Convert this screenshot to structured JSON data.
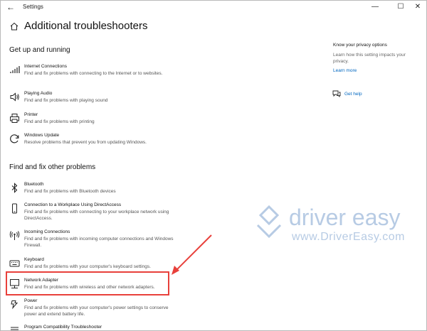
{
  "window": {
    "title": "Settings",
    "back_glyph": "←",
    "minimize_glyph": "—",
    "maximize_glyph": "☐",
    "close_glyph": "✕"
  },
  "page": {
    "title": "Additional troubleshooters"
  },
  "sections": {
    "get_up": {
      "heading": "Get up and running",
      "items": [
        {
          "title": "Internet Connections",
          "desc": "Find and fix problems with connecting to the Internet or to websites.",
          "icon": "wifi-icon"
        },
        {
          "title": "Playing Audio",
          "desc": "Find and fix problems with playing sound",
          "icon": "speaker-icon"
        },
        {
          "title": "Printer",
          "desc": "Find and fix problems with printing",
          "icon": "printer-icon"
        },
        {
          "title": "Windows Update",
          "desc": "Resolve problems that prevent you from updating Windows.",
          "icon": "refresh-icon"
        }
      ]
    },
    "other": {
      "heading": "Find and fix other problems",
      "items": [
        {
          "title": "Bluetooth",
          "desc": "Find and fix problems with Bluetooth devices",
          "icon": "bluetooth-icon"
        },
        {
          "title": "Connection to a Workplace Using DirectAccess",
          "desc": "Find and fix problems with connecting to your workplace network using DirectAccess.",
          "icon": "phone-icon"
        },
        {
          "title": "Incoming Connections",
          "desc": "Find and fix problems with incoming computer connections and Windows Firewall.",
          "icon": "antenna-icon"
        },
        {
          "title": "Keyboard",
          "desc": "Find and fix problems with your computer's keyboard settings.",
          "icon": "keyboard-icon"
        },
        {
          "title": "Network Adapter",
          "desc": "Find and fix problems with wireless and other network adapters.",
          "icon": "monitor-network-icon"
        },
        {
          "title": "Power",
          "desc": "Find and fix problems with your computer's power settings to conserve power and extend battery life.",
          "icon": "power-icon"
        },
        {
          "title": "Program Compatibility Troubleshooter",
          "desc": "",
          "icon": "list-icon"
        }
      ]
    }
  },
  "sidebar": {
    "privacy_title": "Know your privacy options",
    "privacy_desc": "Learn how this setting impacts your privacy.",
    "learn_more": "Learn more",
    "get_help": "Get help"
  },
  "watermark": {
    "brand": "driver easy",
    "url": "www.DriverEasy.com"
  },
  "colors": {
    "accent": "#0067c0",
    "highlight": "#e8403b",
    "watermark": "#b7cbe4"
  }
}
